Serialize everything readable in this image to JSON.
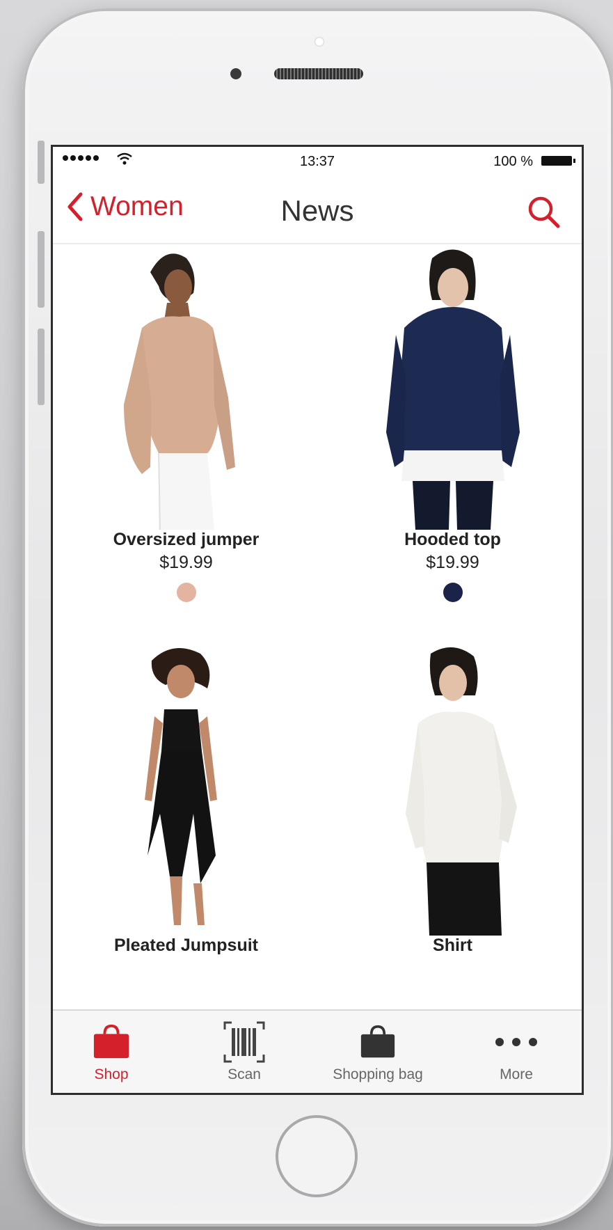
{
  "status_bar": {
    "time": "13:37",
    "battery_text": "100 %"
  },
  "nav": {
    "back_label": "Women",
    "title": "News"
  },
  "products": [
    {
      "name": "Oversized jumper",
      "price": "$19.99",
      "swatch_color": "#e3b4a0"
    },
    {
      "name": "Hooded top",
      "price": "$19.99",
      "swatch_color": "#1b2448"
    },
    {
      "name": "Pleated Jumpsuit",
      "price": ""
    },
    {
      "name": "Shirt",
      "price": ""
    }
  ],
  "tabs": [
    {
      "label": "Shop",
      "icon": "shopping-bag-filled-icon"
    },
    {
      "label": "Scan",
      "icon": "barcode-scan-icon"
    },
    {
      "label": "Shopping bag",
      "icon": "shopping-bag-icon"
    },
    {
      "label": "More",
      "icon": "more-dots-icon"
    }
  ],
  "colors": {
    "accent": "#d3202a",
    "tab_inactive": "#666666"
  }
}
